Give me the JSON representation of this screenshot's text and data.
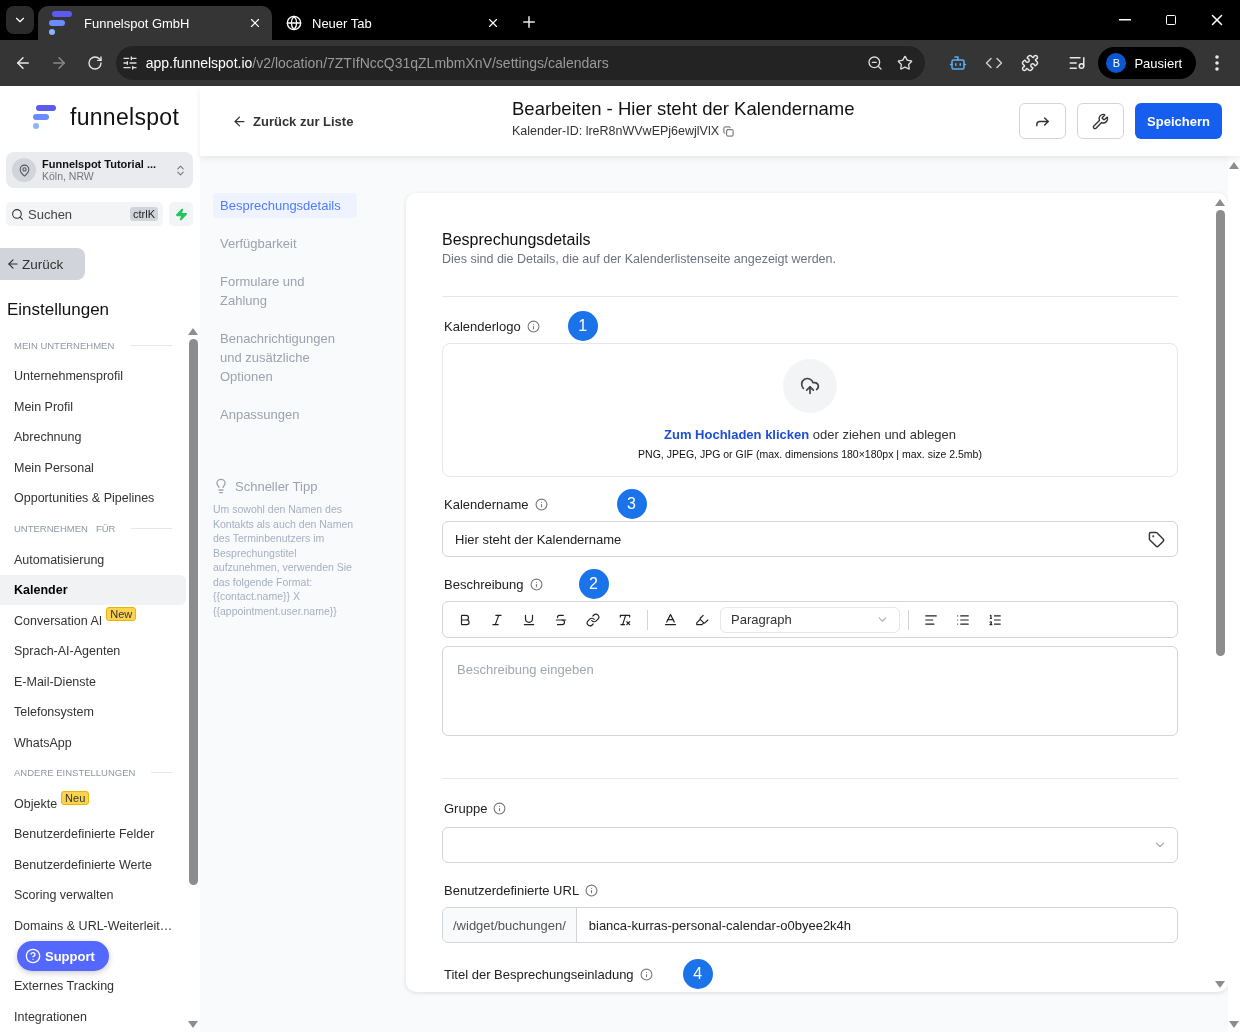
{
  "browser": {
    "tabs": [
      {
        "title": "Funnelspot GmbH",
        "selected": true
      },
      {
        "title": "Neuer Tab",
        "selected": false
      }
    ],
    "url_host": "app.funnelspot.io",
    "url_path": "/v2/location/7ZTIfNccQ31qZLmbmXnV/settings/calendars",
    "profile": {
      "initial": "B",
      "label": "Pausiert"
    }
  },
  "sidebar": {
    "brand": "funnelspot",
    "account": {
      "name": "Funnelspot Tutorial ...",
      "location": "Köln, NRW"
    },
    "search": {
      "placeholder": "Suchen",
      "shortcut": "ctrlK"
    },
    "back_label": "Zurück",
    "heading": "Einstellungen",
    "sections": [
      {
        "label": "MEIN UNTERNEHMEN",
        "items": [
          {
            "label": "Unternehmensprofil",
            "selected": false
          },
          {
            "label": "Mein Profil",
            "selected": false
          },
          {
            "label": "Abrechnung",
            "selected": false
          },
          {
            "label": "Mein Personal",
            "selected": false
          },
          {
            "label": "Opportunities & Pipelines",
            "selected": false
          }
        ]
      },
      {
        "label": "UNTERNEHMEN",
        "label_extra": "FÜR",
        "items": [
          {
            "label": "Automatisierung",
            "selected": false
          },
          {
            "label": "Kalender",
            "selected": true
          },
          {
            "label": "Conversation AI",
            "selected": false,
            "badge": "New"
          },
          {
            "label": "Sprach-AI-Agenten",
            "selected": false
          },
          {
            "label": "E-Mail-Dienste",
            "selected": false
          },
          {
            "label": "Telefonsystem",
            "selected": false
          },
          {
            "label": "WhatsApp",
            "selected": false
          }
        ]
      },
      {
        "label": "ANDERE EINSTELLUNGEN",
        "items": [
          {
            "label": "Objekte",
            "selected": false,
            "badge": "Neu"
          },
          {
            "label": "Benutzerdefinierte Felder",
            "selected": false
          },
          {
            "label": "Benutzerdefinierte Werte",
            "selected": false
          },
          {
            "label": "Scoring verwalten",
            "selected": false
          },
          {
            "label": "Domains & URL-Weiterleit…",
            "selected": false
          },
          {
            "label": "Externes Tracking",
            "selected": false
          },
          {
            "label": "Integrationen",
            "selected": false
          }
        ]
      }
    ],
    "support_label": "Support"
  },
  "header": {
    "back_label": "Zurück zur Liste",
    "title": "Bearbeiten - Hier steht der Kalendername",
    "calendar_id": "Kalender-ID: lreR8nWVwEPj6ewjlVlX",
    "save_label": "Speichern"
  },
  "subnav": {
    "items": [
      {
        "label": "Besprechungsdetails",
        "selected": true
      },
      {
        "label": "Verfügbarkeit",
        "selected": false
      },
      {
        "label": "Formulare und Zahlung",
        "selected": false
      },
      {
        "label": "Benachrichtigungen und zusätzliche Optionen",
        "selected": false
      },
      {
        "label": "Anpassungen",
        "selected": false
      }
    ],
    "tip": {
      "title": "Schneller Tipp",
      "text": "Um sowohl den Namen des Kontakts als auch den Namen des Terminbenutzers im Besprechungstitel aufzunehmen, verwenden Sie das folgende Format: {{contact.name}} X {{appointment.user.name}}"
    }
  },
  "form": {
    "title": "Besprechungsdetails",
    "subtitle": "Dies sind die Details, die auf der Kalenderlistenseite angezeigt werden.",
    "logo": {
      "label": "Kalenderlogo",
      "marker": "1",
      "upload_link": "Zum Hochladen klicken",
      "upload_text": "oder ziehen und ablegen",
      "upload_hint": "PNG, JPEG, JPG or GIF (max. dimensions 180×180px | max. size 2.5mb)"
    },
    "name": {
      "label": "Kalendername",
      "marker": "3",
      "value": "Hier steht der Kalendername"
    },
    "description": {
      "label": "Beschreibung",
      "marker": "2",
      "block_format": "Paragraph",
      "placeholder": "Beschreibung eingeben"
    },
    "group": {
      "label": "Gruppe"
    },
    "url": {
      "label": "Benutzerdefinierte URL",
      "prefix": "/widget/buchungen/",
      "value": "bianca-kurras-personal-calendar-o0byee2k4h"
    },
    "invite_title": {
      "label": "Titel der Besprechungseinladung",
      "marker": "4"
    }
  }
}
